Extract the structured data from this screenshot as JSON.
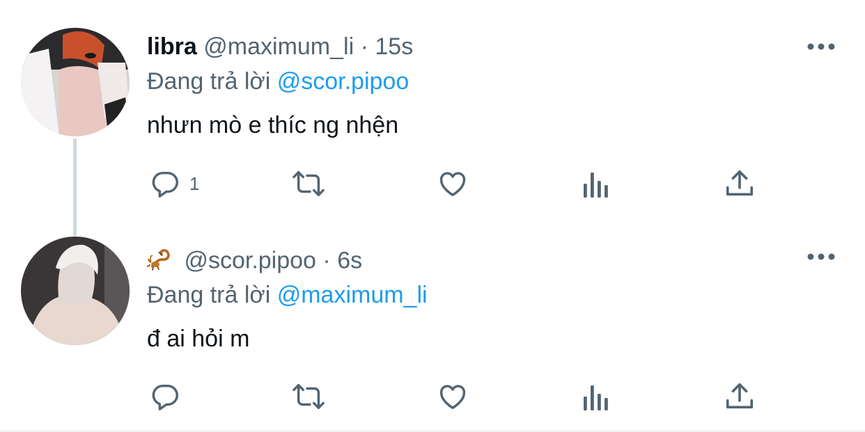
{
  "tweets": [
    {
      "display_name": "libra",
      "handle": "@maximum_li",
      "separator": "·",
      "time": "15s",
      "reply_prefix": "Đang trả lời",
      "reply_to": "@scor.pipoo",
      "text": "nhưn mò e thíc ng nhện",
      "reply_count": "1",
      "avatar_icon": "person-covering-face-avatar"
    },
    {
      "display_name_emoji": "scorpion-emoji",
      "handle": "@scor.pipoo",
      "separator": "·",
      "time": "6s",
      "reply_prefix": "Đang trả lời",
      "reply_to": "@maximum_li",
      "text": "đ ai hỏi m",
      "reply_count": "",
      "avatar_icon": "person-back-white-hair-avatar"
    }
  ],
  "colors": {
    "text": "#0f1419",
    "secondary": "#536471",
    "mention": "#1d9bf0",
    "thread_line": "#cfd9de"
  },
  "icons": [
    "reply-icon",
    "retweet-icon",
    "like-icon",
    "views-icon",
    "share-icon",
    "more-icon"
  ]
}
